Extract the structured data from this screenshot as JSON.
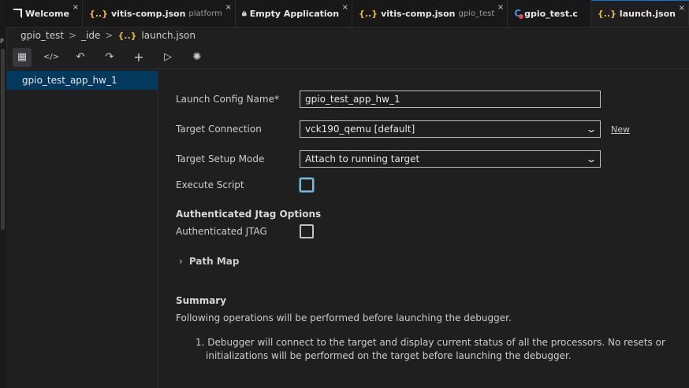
{
  "tabs": [
    {
      "label": "Welcome",
      "sub": "",
      "icon": "amd-logo-icon",
      "active": false
    },
    {
      "label": "vitis-comp.json",
      "sub": "platform",
      "icon": "json-icon",
      "active": false
    },
    {
      "label": "Empty Application",
      "sub": "",
      "icon": "lock-icon",
      "active": false
    },
    {
      "label": "vitis-comp.json",
      "sub": "gpio_test",
      "icon": "json-icon",
      "active": false
    },
    {
      "label": "gpio_test.c",
      "sub": "",
      "icon": "c-file-icon",
      "active": false
    },
    {
      "label": "launch.json",
      "sub": "",
      "icon": "json-icon",
      "active": true
    }
  ],
  "json_icon_glyph": "{..}",
  "close_glyph": "×",
  "breadcrumb": {
    "root": "gpio_test",
    "folder": "_ide",
    "file": "launch.json",
    "sep": ">"
  },
  "toolbar": [
    {
      "name": "table-view-icon",
      "glyph": "▦"
    },
    {
      "name": "code-view-icon",
      "glyph": "</>"
    },
    {
      "name": "undo-icon",
      "glyph": "↶"
    },
    {
      "name": "redo-icon",
      "glyph": "↷"
    },
    {
      "name": "add-icon",
      "glyph": "+"
    },
    {
      "name": "run-icon",
      "glyph": "▷"
    },
    {
      "name": "debug-icon",
      "glyph": "✺"
    }
  ],
  "configs": [
    "gpio_test_app_hw_1"
  ],
  "form": {
    "name_label": "Launch Config Name*",
    "name_value": "gpio_test_app_hw_1",
    "target_label": "Target Connection",
    "target_value": "vck190_qemu [default]",
    "new_link": "New",
    "mode_label": "Target Setup Mode",
    "mode_value": "Attach to running target",
    "script_label": "Execute Script",
    "jtag_section": "Authenticated Jtag Options",
    "jtag_label": "Authenticated JTAG",
    "path_map": "Path Map",
    "summary_title": "Summary",
    "summary_text": "Following operations will be performed before launching the debugger.",
    "summary_item_1": "1. Debugger will connect to the target and display current status of all the processors. No resets or",
    "summary_item_2": "initializations will be performed on the target before launching the debugger."
  },
  "colors": {
    "accent": "#0078d4",
    "selection": "#04395e",
    "json": "#e5b93a"
  }
}
